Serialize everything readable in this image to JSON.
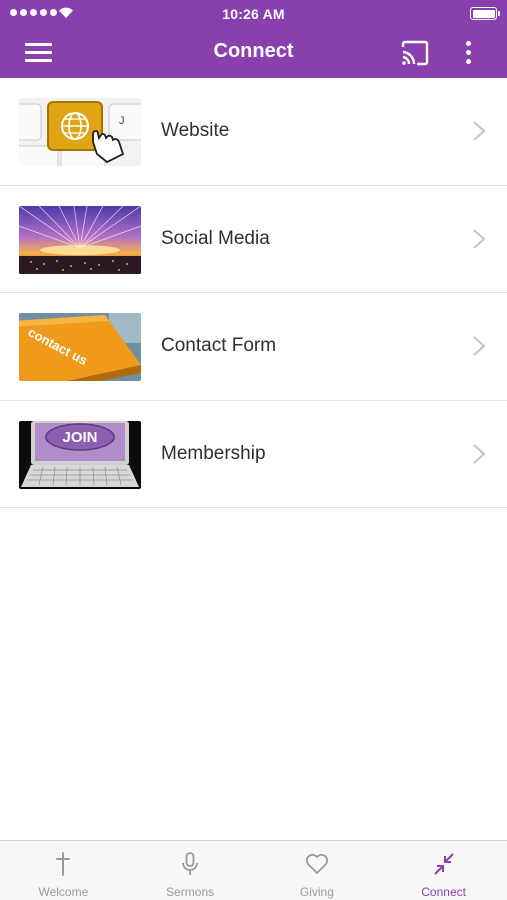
{
  "status_bar": {
    "time": "10:26 AM"
  },
  "nav": {
    "title": "Connect",
    "menu_icon": "hamburger-menu-icon",
    "cast_icon": "cast-icon",
    "more_icon": "vertical-ellipsis-icon"
  },
  "list": {
    "items": [
      {
        "label": "Website",
        "thumbnail": "keyboard-globe-key-image"
      },
      {
        "label": "Social Media",
        "thumbnail": "sunset-city-lights-image"
      },
      {
        "label": "Contact Form",
        "thumbnail": "contact-us-key-image",
        "thumbnail_text": "contact us"
      },
      {
        "label": "Membership",
        "thumbnail": "join-laptop-image",
        "thumbnail_text": "JOIN"
      }
    ]
  },
  "tab_bar": {
    "tabs": [
      {
        "label": "Welcome",
        "icon": "cross-icon",
        "active": false
      },
      {
        "label": "Sermons",
        "icon": "microphone-icon",
        "active": false
      },
      {
        "label": "Giving",
        "icon": "heart-icon",
        "active": false
      },
      {
        "label": "Connect",
        "icon": "compress-arrows-icon",
        "active": true
      }
    ]
  },
  "colors": {
    "brand_purple": "#8a3faf",
    "inactive_tab": "#9a9a9a",
    "divider": "#e3e3e3"
  }
}
